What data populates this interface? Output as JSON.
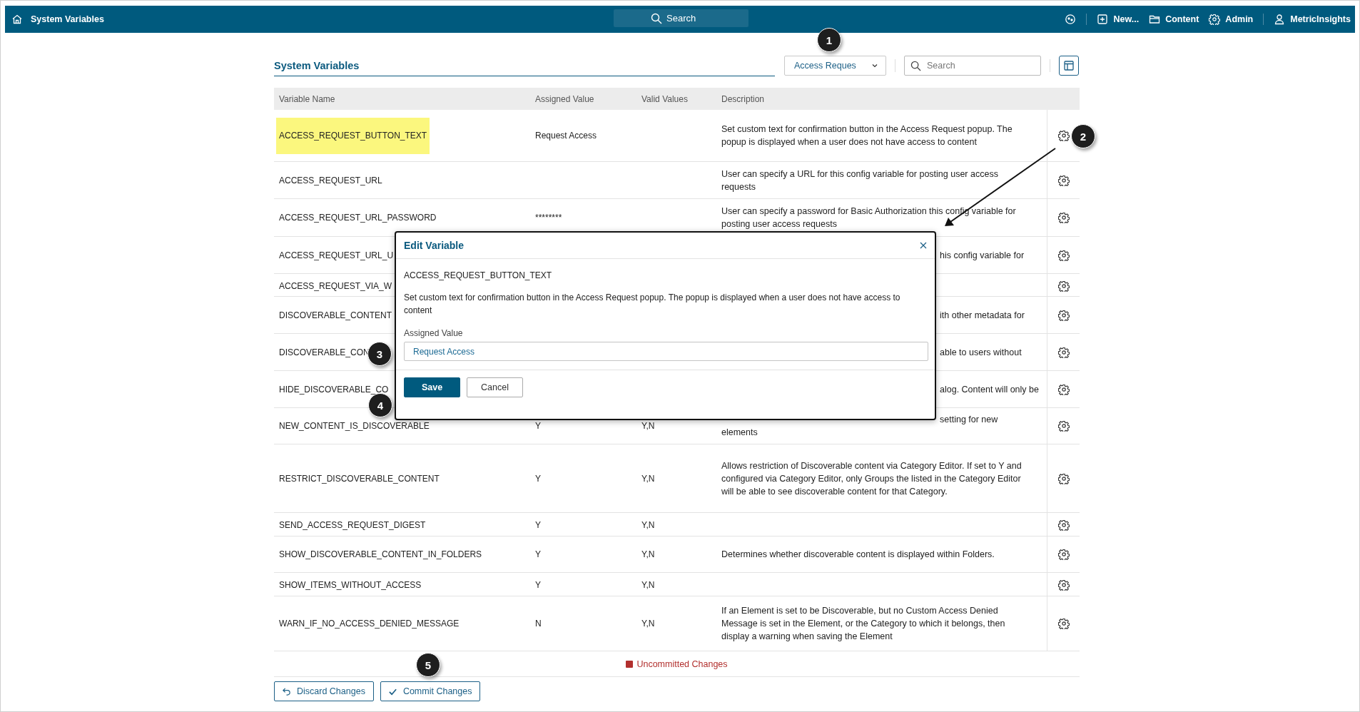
{
  "topbar": {
    "title": "System Variables",
    "search": {
      "placeholder": "Search"
    },
    "items": [
      {
        "kind": "status"
      },
      {
        "kind": "new",
        "label": "New..."
      },
      {
        "kind": "content",
        "label": "Content"
      },
      {
        "kind": "admin",
        "label": "Admin"
      },
      {
        "kind": "user",
        "label": "MetricInsights"
      }
    ]
  },
  "toolbar": {
    "title": "System Variables",
    "filter": {
      "value": "Access Reques"
    },
    "search": {
      "placeholder": "Search"
    }
  },
  "table": {
    "columns": [
      "Variable Name",
      "Assigned Value",
      "Valid Values",
      "Description"
    ],
    "rows": [
      {
        "kind": "full",
        "highlighted": true,
        "name": "ACCESS_REQUEST_BUTTON_TEXT",
        "value": "Request Access",
        "description": "Set custom text for confirmation button in the Access Request popup. The popup is displayed when a user does not have access to content"
      },
      {
        "kind": "full",
        "highlighted": false,
        "name": "ACCESS_REQUEST_URL",
        "description": "User can specify a URL for this config variable for posting user access requests"
      },
      {
        "kind": "full",
        "highlighted": false,
        "name": "ACCESS_REQUEST_URL_PASSWORD",
        "value": "********",
        "description": "User can specify a password for Basic Authorization this config variable for posting user access requests"
      },
      {
        "kind": "partial",
        "highlighted": false,
        "name": "ACCESS_REQUEST_URL_U",
        "description": "his config variable for"
      },
      {
        "kind": "partial",
        "highlighted": false,
        "name": "ACCESS_REQUEST_VIA_W"
      },
      {
        "kind": "partial",
        "highlighted": false,
        "name": "DISCOVERABLE_CONTENT",
        "description": "ith other metadata for"
      },
      {
        "kind": "partial",
        "highlighted": false,
        "name": "DISCOVERABLE_CON",
        "description": "able to users without"
      },
      {
        "kind": "partial",
        "highlighted": false,
        "name": "HIDE_DISCOVERABLE_CO",
        "description": "alog. Content will only be"
      },
      {
        "kind": "partial",
        "highlighted": false,
        "name": "NEW_CONTENT_IS_DISCOVERABLE",
        "value": "Y",
        "valid": "Y,N",
        "description": "setting for new",
        "description_continued": "elements"
      },
      {
        "kind": "full",
        "highlighted": false,
        "name": "RESTRICT_DISCOVERABLE_CONTENT",
        "value": "Y",
        "valid": "Y,N",
        "description": "Allows restriction of Discoverable content via Category Editor. If set to Y and configured via Category Editor, only Groups the listed in the Category Editor will be able to see discoverable content for that Category."
      },
      {
        "kind": "full",
        "highlighted": false,
        "name": "SEND_ACCESS_REQUEST_DIGEST",
        "value": "Y",
        "valid": "Y,N"
      },
      {
        "kind": "full",
        "highlighted": false,
        "name": "SHOW_DISCOVERABLE_CONTENT_IN_FOLDERS",
        "value": "Y",
        "valid": "Y,N",
        "description": "Determines whether discoverable content is displayed within Folders."
      },
      {
        "kind": "full",
        "highlighted": false,
        "name": "SHOW_ITEMS_WITHOUT_ACCESS",
        "value": "Y",
        "valid": "Y,N"
      },
      {
        "kind": "full",
        "highlighted": false,
        "name": "WARN_IF_NO_ACCESS_DENIED_MESSAGE",
        "value": "N",
        "valid": "Y,N",
        "description": "If an Element is set to be Discoverable, but no Custom Access Denied Message is set in the Element, or the Category to which it belongs, then display a warning when saving the Element"
      }
    ]
  },
  "footer": {
    "status": "Uncommitted Changes",
    "buttons": [
      {
        "kind": "discard",
        "label": "Discard Changes"
      },
      {
        "kind": "commit",
        "label": "Commit Changes"
      }
    ]
  },
  "modal": {
    "title": "Edit Variable",
    "variable": "ACCESS_REQUEST_BUTTON_TEXT",
    "description": "Set custom text for confirmation button in the Access Request popup. The popup is displayed when a user does not have access to content",
    "field": {
      "label": "Assigned Value",
      "value": "Request Access"
    },
    "buttons": [
      {
        "kind": "primary",
        "label": "Save"
      },
      {
        "kind": "secondary",
        "label": "Cancel"
      }
    ]
  },
  "callouts": [
    {
      "label": "1"
    },
    {
      "label": "2"
    },
    {
      "label": "3"
    },
    {
      "label": "4"
    },
    {
      "label": "5"
    }
  ]
}
